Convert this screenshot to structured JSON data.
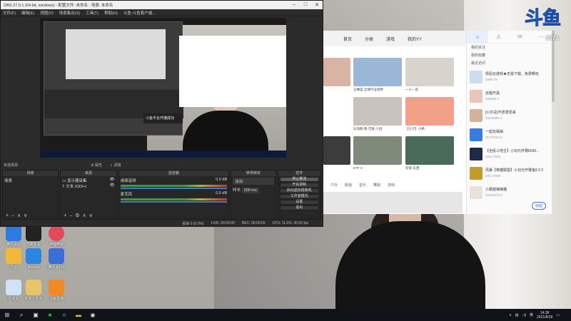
{
  "obs": {
    "title": "OBS 27.0.1 (64-bit, windows) - 配置文件: 未命名 - 场景: 未命名",
    "menu": [
      "文件(F)",
      "编辑(E)",
      "视图(V)",
      "场景集合(S)",
      "工具(T)",
      "帮助(H)",
      "斗鱼-斗鱼客户端..."
    ],
    "preview_toast": "斗鱼平台开播成功",
    "scene_bar": {
      "left": "未选择源",
      "properties": "属性",
      "filters": "滤镜"
    },
    "docks": {
      "scenes": {
        "title": "场景",
        "items": [
          "场景"
        ]
      },
      "sources": {
        "title": "来源",
        "items": [
          "显示器采集",
          "文本 (GDI+)"
        ]
      },
      "mixer": {
        "title": "混音器",
        "tracks": [
          {
            "name": "桌面音频",
            "level": "0.0 dB"
          },
          {
            "name": "麦克风",
            "level": "0.0 dB"
          }
        ]
      },
      "transitions": {
        "title": "转场特效",
        "type": "淡出",
        "duration_label": "时长",
        "duration": "300 ms"
      },
      "controls": {
        "title": "控件",
        "buttons": [
          "停止推流",
          "开始录制",
          "启动虚拟摄像机",
          "工作室模式",
          "设置",
          "退出"
        ]
      }
    },
    "status": {
      "drop": "丢帧 0 (0.0%)",
      "live": "LIVE: 00:00:00",
      "rec": "REC: 00:00:00",
      "cpu": "CPU: 11.5%, 30.00 fps"
    }
  },
  "browser": {
    "tabs": [
      "首页",
      "分类",
      "游戏",
      "我的YY"
    ],
    "thumb_captions": [
      "五棵菜-全球行业视界",
      "1.2万",
      "一人一首",
      "乐淘网-我·可爱·少侣",
      "【七夕】小希",
      "ETF·X",
      "欢快·东西",
      "户外",
      "颜值",
      "音乐",
      "舞蹈",
      "游戏"
    ],
    "sidebar": {
      "links": [
        "我的关注",
        "我的收藏",
        "最近访问"
      ],
      "items": [
        {
          "name": "情侣云游戏★无需下载、免费畅玩",
          "stats": "2596.7w"
        },
        {
          "name": "远程开黑",
          "stats": "229299  0"
        },
        {
          "name": "[小尔总]不愿意爱来",
          "stats": "23346662  0"
        },
        {
          "name": "一起玩歌曲",
          "stats": "21737164  0"
        },
        {
          "name": "【全民斗地主】小勾元开赛8260...",
          "stats": "1614  1532"
        },
        {
          "name": "风暴【英雄联盟】小勾元开赛金8 9 2",
          "stats": "490  17066"
        },
        {
          "name": "小蘑菇梅梅猫",
          "stats": "21603473  0"
        }
      ],
      "collapse": "收起"
    }
  },
  "brand": {
    "logo": "斗鱼",
    "room": "8073"
  },
  "desktop_icons": [
    "腾讯会议",
    "优酷影视",
    "哔哩哔哩",
    "迅雷",
    "Navicat",
    "腾讯会议2",
    "回收站",
    "新建文件夹",
    "斗鱼直播"
  ],
  "taskbar": {
    "time": "14:38",
    "date": "2021/8/28",
    "lang": "英"
  }
}
